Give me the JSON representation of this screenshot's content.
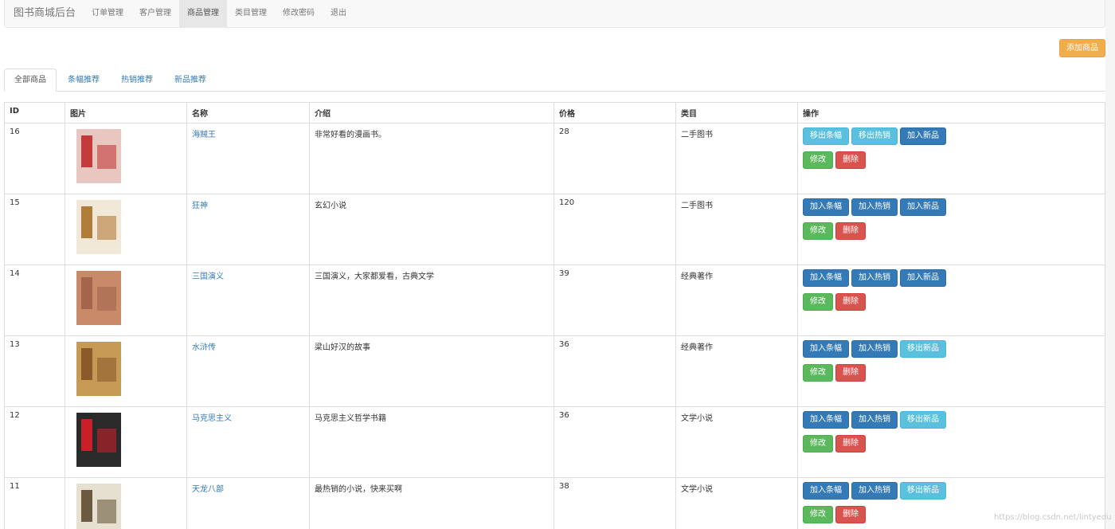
{
  "navbar": {
    "brand": "图书商城后台",
    "items": [
      "订单管理",
      "客户管理",
      "商品管理",
      "类目管理",
      "修改密码",
      "退出"
    ],
    "active_index": 2
  },
  "add_button": "添加商品",
  "tabs": [
    "全部商品",
    "条幅推荐",
    "热销推荐",
    "新品推荐"
  ],
  "active_tab": 0,
  "table": {
    "headers": [
      "ID",
      "图片",
      "名称",
      "介绍",
      "价格",
      "类目",
      "操作"
    ],
    "edit_label": "修改",
    "delete_label": "删除",
    "rows": [
      {
        "id": "16",
        "name": "海贼王",
        "intro": "非常好看的漫画书。",
        "price": "28",
        "category": "二手图书",
        "actions": [
          {
            "label": "移出条幅",
            "style": "info"
          },
          {
            "label": "移出热销",
            "style": "info"
          },
          {
            "label": "加入新品",
            "style": "primary"
          }
        ],
        "cover": {
          "bg": "#e8c7c0",
          "accent": "#c43b3b"
        }
      },
      {
        "id": "15",
        "name": "狂神",
        "intro": "玄幻小说",
        "price": "120",
        "category": "二手图书",
        "actions": [
          {
            "label": "加入条幅",
            "style": "primary"
          },
          {
            "label": "加入热销",
            "style": "primary"
          },
          {
            "label": "加入新品",
            "style": "primary"
          }
        ],
        "cover": {
          "bg": "#f2e8d8",
          "accent": "#b07c3a"
        }
      },
      {
        "id": "14",
        "name": "三国演义",
        "intro": "三国演义，大家都爱看，古典文学",
        "price": "39",
        "category": "经典著作",
        "actions": [
          {
            "label": "加入条幅",
            "style": "primary"
          },
          {
            "label": "加入热销",
            "style": "primary"
          },
          {
            "label": "加入新品",
            "style": "primary"
          }
        ],
        "cover": {
          "bg": "#c98a6a",
          "accent": "#a4664a"
        }
      },
      {
        "id": "13",
        "name": "水浒传",
        "intro": "梁山好汉的故事",
        "price": "36",
        "category": "经典著作",
        "actions": [
          {
            "label": "加入条幅",
            "style": "primary"
          },
          {
            "label": "加入热销",
            "style": "primary"
          },
          {
            "label": "移出新品",
            "style": "info"
          }
        ],
        "cover": {
          "bg": "#c59a55",
          "accent": "#8a5a2a"
        }
      },
      {
        "id": "12",
        "name": "马克思主义",
        "intro": "马克思主义哲学书籍",
        "price": "36",
        "category": "文学小说",
        "actions": [
          {
            "label": "加入条幅",
            "style": "primary"
          },
          {
            "label": "加入热销",
            "style": "primary"
          },
          {
            "label": "移出新品",
            "style": "info"
          }
        ],
        "cover": {
          "bg": "#2a2a2a",
          "accent": "#c8202a"
        }
      },
      {
        "id": "11",
        "name": "天龙八部",
        "intro": "最热销的小说，快来买啊",
        "price": "38",
        "category": "文学小说",
        "actions": [
          {
            "label": "加入条幅",
            "style": "primary"
          },
          {
            "label": "加入热销",
            "style": "primary"
          },
          {
            "label": "移出新品",
            "style": "info"
          }
        ],
        "cover": {
          "bg": "#e6e0d0",
          "accent": "#6b5a40"
        }
      }
    ]
  },
  "watermark": "https://blog.csdn.net/lintyedu"
}
